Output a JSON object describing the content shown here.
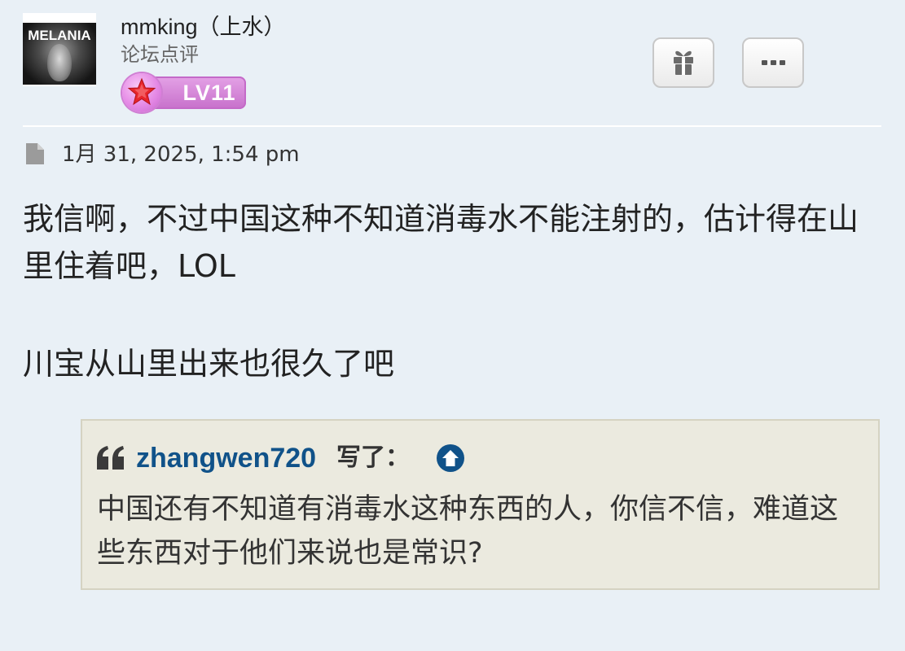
{
  "user": {
    "name": "mmking（上水）",
    "subtitle": "论坛点评",
    "avatar_text": "MELANIA",
    "level": "LV11"
  },
  "actions": {
    "gift_icon": "gift-icon",
    "more_icon": "ellipsis-icon"
  },
  "post": {
    "date": "1月 31, 2025, 1:54 pm",
    "paragraphs": [
      "我信啊，不过中国这种不知道消毒水不能注射的，估计得在山里住着吧，LOL",
      "川宝从山里出来也很久了吧"
    ]
  },
  "quote": {
    "author": "zhangwen720",
    "wrote_label": "写了：",
    "text": "中国还有不知道有消毒水这种东西的人，你信不信，难道这些东西对于他们来说也是常识?"
  },
  "colors": {
    "background": "#e9f0f6",
    "quote_background": "#ebeadf",
    "link_blue": "#105289",
    "level_badge": "#c770cb"
  }
}
